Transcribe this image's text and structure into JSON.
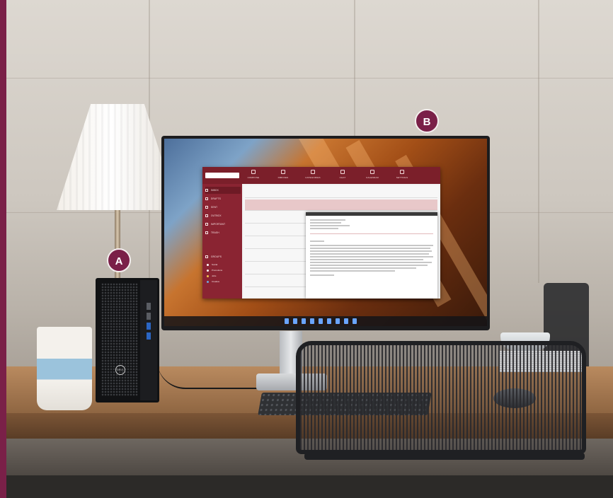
{
  "callouts": {
    "a": "A",
    "b": "B"
  },
  "tower": {
    "brand": "DELL"
  },
  "mail_app": {
    "toolbar": [
      "COMPOSE",
      "INBOXES",
      "CATEGORIES",
      "CHAT",
      "CALENDAR",
      "SETTINGS"
    ],
    "sidebar": [
      "INBOX",
      "DRAFTS",
      "SENT",
      "OUTBOX",
      "IMPORTANT",
      "TRASH"
    ],
    "groups_label": "GROUPS",
    "groups": [
      "Social",
      "Promotions",
      "Jobs",
      "Creative"
    ],
    "inbox_badge": "1"
  },
  "colors": {
    "accent": "#7a2048",
    "app_bar": "#7b1f2a"
  }
}
